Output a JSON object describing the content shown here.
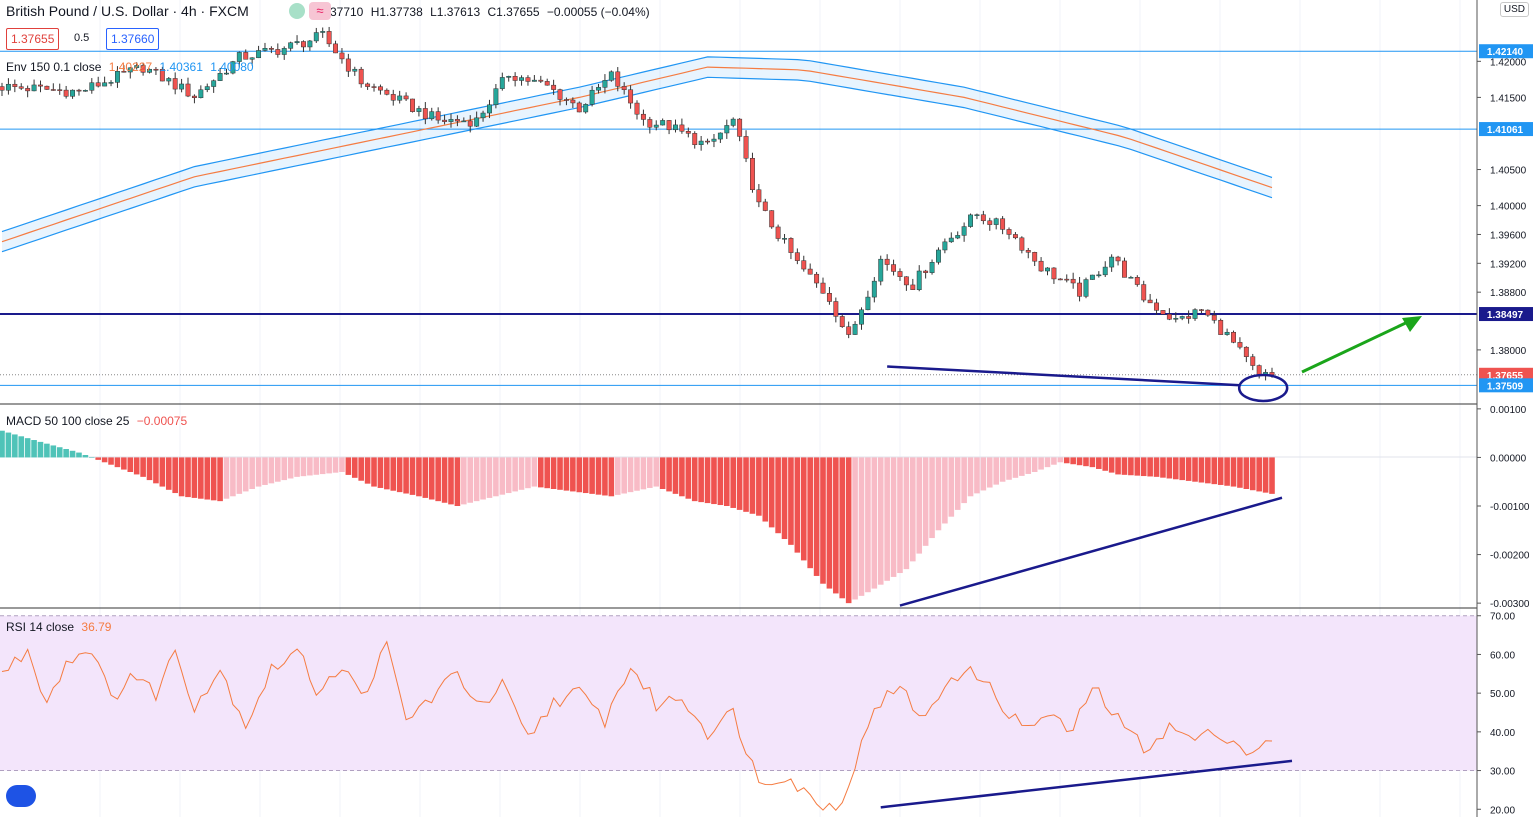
{
  "header": {
    "symbol": "British Pound / U.S. Dollar · 4h · FXCM",
    "open": "O1.37710",
    "high": "H1.37738",
    "low": "L1.37613",
    "close": "C1.37655",
    "change": "−0.00055 (−0.04%)",
    "bid": "1.37655",
    "spread": "0.5",
    "ask": "1.37660",
    "currency": "USD"
  },
  "colors": {
    "up": "#26a69a",
    "down": "#ef5350",
    "env_basis": "#f57c42",
    "env_band": "#2196f3",
    "drawing": "#1a1a8c",
    "arrow": "#1aa51a",
    "rsi": "#f57c42",
    "macd_strong": "#ef5350",
    "macd_weak": "#f8bbc6",
    "macd_pos": "#4fc3b8"
  },
  "legends": {
    "env": "Env 150 0.1 close",
    "env_basis": "1.40227",
    "env_upper": "1.40361",
    "env_lower": "1.40080",
    "macd": "MACD 50 100 close 25",
    "macd_value": "−0.00075",
    "rsi": "RSI 14 close",
    "rsi_value": "36.79"
  },
  "chart_data": [
    {
      "type": "candlestick",
      "title": "British Pound / U.S. Dollar · 4h · FXCM",
      "ylim": [
        1.3725,
        1.4285
      ],
      "y_ticks": [
        "1.42000",
        "1.41500",
        "1.40500",
        "1.40000",
        "1.39600",
        "1.39200",
        "1.38800",
        "1.38000"
      ],
      "price_labels": [
        {
          "value": "1.42140",
          "color": "#2196f3"
        },
        {
          "value": "1.41061",
          "color": "#2196f3"
        },
        {
          "value": "1.38497",
          "color": "#1a1a8c"
        },
        {
          "value": "1.37655",
          "color": "#ef5350"
        },
        {
          "value": "1.37509",
          "color": "#2196f3"
        }
      ],
      "horizontal_levels": [
        1.4214,
        1.41061,
        1.38497,
        1.37509
      ],
      "trendline": {
        "from": 1.3777,
        "to": 1.3751
      },
      "last_close": 1.37655,
      "bars": 150,
      "anchors": [
        [
          0,
          1.4165
        ],
        [
          12,
          1.4158
        ],
        [
          22,
          1.4192
        ],
        [
          30,
          1.4152
        ],
        [
          37,
          1.4205
        ],
        [
          44,
          1.4218
        ],
        [
          50,
          1.4235
        ],
        [
          56,
          1.4172
        ],
        [
          62,
          1.4145
        ],
        [
          68,
          1.4118
        ],
        [
          74,
          1.4118
        ],
        [
          79,
          1.4183
        ],
        [
          85,
          1.4165
        ],
        [
          90,
          1.4135
        ],
        [
          95,
          1.418
        ],
        [
          100,
          1.4118
        ],
        [
          104,
          1.411
        ],
        [
          110,
          1.4082
        ],
        [
          114,
          1.4118
        ],
        [
          118,
          1.4
        ],
        [
          124,
          1.392
        ],
        [
          129,
          1.3872
        ],
        [
          132,
          1.3815
        ],
        [
          137,
          1.3925
        ],
        [
          142,
          1.389
        ],
        [
          147,
          1.395
        ],
        [
          152,
          1.3988
        ],
        [
          157,
          1.3965
        ],
        [
          162,
          1.3915
        ],
        [
          168,
          1.388
        ],
        [
          173,
          1.393
        ],
        [
          178,
          1.3872
        ],
        [
          183,
          1.384
        ],
        [
          187,
          1.3855
        ],
        [
          191,
          1.382
        ],
        [
          196,
          1.3762
        ],
        [
          198,
          1.3766
        ]
      ],
      "envelope": {
        "basis": [
          [
            0,
            1.395
          ],
          [
            30,
            1.404
          ],
          [
            60,
            1.4095
          ],
          [
            90,
            1.415
          ],
          [
            110,
            1.4192
          ],
          [
            125,
            1.4188
          ],
          [
            150,
            1.415
          ],
          [
            175,
            1.4095
          ],
          [
            198,
            1.4025
          ]
        ],
        "width_pct": 0.1
      }
    },
    {
      "type": "histogram",
      "title": "MACD 50 100 close 25",
      "ylim": [
        -0.0031,
        0.0011
      ],
      "y_ticks": [
        "0.00100",
        "0.00000",
        "-0.00100",
        "-0.00200",
        "-0.00300"
      ],
      "anchors": [
        [
          0,
          0.00055
        ],
        [
          6,
          0.00032
        ],
        [
          12,
          0.0001
        ],
        [
          16,
          -0.0001
        ],
        [
          22,
          -0.0004
        ],
        [
          28,
          -0.0008
        ],
        [
          34,
          -0.0009
        ],
        [
          40,
          -0.0006
        ],
        [
          46,
          -0.0004
        ],
        [
          53,
          -0.0003
        ],
        [
          58,
          -0.0006
        ],
        [
          65,
          -0.0008
        ],
        [
          71,
          -0.001
        ],
        [
          77,
          -0.0008
        ],
        [
          83,
          -0.0006
        ],
        [
          89,
          -0.0007
        ],
        [
          95,
          -0.0008
        ],
        [
          102,
          -0.0006
        ],
        [
          108,
          -0.0009
        ],
        [
          113,
          -0.001
        ],
        [
          118,
          -0.0012
        ],
        [
          123,
          -0.0018
        ],
        [
          128,
          -0.0026
        ],
        [
          132,
          -0.003
        ],
        [
          136,
          -0.0027
        ],
        [
          141,
          -0.0023
        ],
        [
          146,
          -0.0015
        ],
        [
          151,
          -0.0008
        ],
        [
          156,
          -0.0005
        ],
        [
          161,
          -0.0003
        ],
        [
          165,
          -0.0001
        ],
        [
          170,
          -0.0002
        ],
        [
          174,
          -0.00035
        ],
        [
          180,
          -0.0004
        ],
        [
          186,
          -0.0005
        ],
        [
          192,
          -0.0006
        ],
        [
          198,
          -0.00075
        ]
      ],
      "trendline": {
        "from": -0.00305,
        "to": -0.00083
      }
    },
    {
      "type": "line",
      "title": "RSI 14 close",
      "ylim": [
        18,
        72
      ],
      "y_ticks": [
        "70.00",
        "60.00",
        "50.00",
        "40.00",
        "30.00",
        "20.00"
      ],
      "band": [
        30,
        70
      ],
      "anchors": [
        [
          0,
          55
        ],
        [
          4,
          61
        ],
        [
          7,
          48
        ],
        [
          10,
          58
        ],
        [
          14,
          62
        ],
        [
          17,
          48
        ],
        [
          20,
          55
        ],
        [
          24,
          50
        ],
        [
          27,
          61
        ],
        [
          30,
          47
        ],
        [
          34,
          56
        ],
        [
          38,
          42
        ],
        [
          42,
          56
        ],
        [
          46,
          61
        ],
        [
          49,
          51
        ],
        [
          53,
          57
        ],
        [
          56,
          49
        ],
        [
          60,
          62
        ],
        [
          63,
          43
        ],
        [
          67,
          49
        ],
        [
          71,
          55
        ],
        [
          75,
          46
        ],
        [
          78,
          52
        ],
        [
          82,
          38
        ],
        [
          86,
          48
        ],
        [
          90,
          50
        ],
        [
          94,
          43
        ],
        [
          98,
          57
        ],
        [
          102,
          47
        ],
        [
          106,
          49
        ],
        [
          110,
          40
        ],
        [
          114,
          45
        ],
        [
          118,
          27
        ],
        [
          122,
          29
        ],
        [
          126,
          23
        ],
        [
          130,
          20
        ],
        [
          133,
          31
        ],
        [
          136,
          47
        ],
        [
          140,
          51
        ],
        [
          144,
          43
        ],
        [
          148,
          55
        ],
        [
          152,
          55
        ],
        [
          155,
          49
        ],
        [
          159,
          41
        ],
        [
          163,
          44
        ],
        [
          167,
          40
        ],
        [
          170,
          52
        ],
        [
          174,
          43
        ],
        [
          178,
          36
        ],
        [
          182,
          41
        ],
        [
          186,
          38
        ],
        [
          190,
          40
        ],
        [
          194,
          35
        ],
        [
          198,
          36.8
        ]
      ],
      "trendline": {
        "from": 20.5,
        "to": 32.5
      }
    }
  ]
}
